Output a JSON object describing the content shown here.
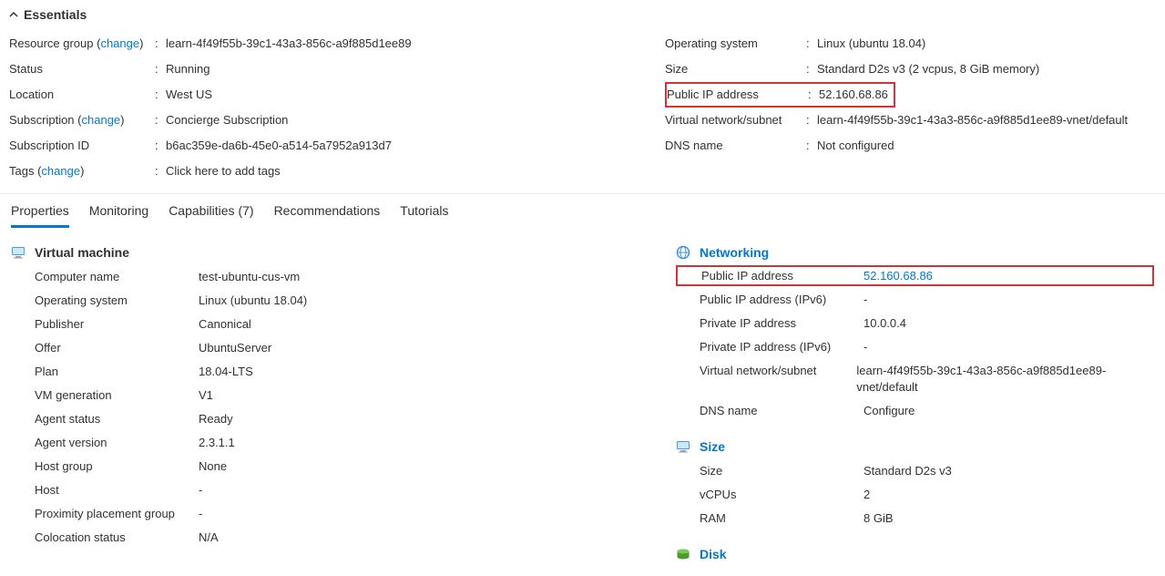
{
  "essentials": {
    "title": "Essentials",
    "left": {
      "resource_group_label": "Resource group",
      "resource_group_change": "change",
      "resource_group_value": "learn-4f49f55b-39c1-43a3-856c-a9f885d1ee89",
      "status_label": "Status",
      "status_value": "Running",
      "location_label": "Location",
      "location_value": "West US",
      "subscription_label": "Subscription",
      "subscription_change": "change",
      "subscription_value": "Concierge Subscription",
      "subscription_id_label": "Subscription ID",
      "subscription_id_value": "b6ac359e-da6b-45e0-a514-5a7952a913d7",
      "tags_label": "Tags",
      "tags_change": "change",
      "tags_value": "Click here to add tags"
    },
    "right": {
      "os_label": "Operating system",
      "os_value": "Linux (ubuntu 18.04)",
      "size_label": "Size",
      "size_value": "Standard D2s v3 (2 vcpus, 8 GiB memory)",
      "public_ip_label": "Public IP address",
      "public_ip_value": "52.160.68.86",
      "vnet_label": "Virtual network/subnet",
      "vnet_value": "learn-4f49f55b-39c1-43a3-856c-a9f885d1ee89-vnet/default",
      "dns_label": "DNS name",
      "dns_value": "Not configured"
    }
  },
  "tabs": {
    "properties": "Properties",
    "monitoring": "Monitoring",
    "capabilities": "Capabilities (7)",
    "recommendations": "Recommendations",
    "tutorials": "Tutorials"
  },
  "vm": {
    "title": "Virtual machine",
    "computer_name_label": "Computer name",
    "computer_name_value": "test-ubuntu-cus-vm",
    "os_label": "Operating system",
    "os_value": "Linux (ubuntu 18.04)",
    "publisher_label": "Publisher",
    "publisher_value": "Canonical",
    "offer_label": "Offer",
    "offer_value": "UbuntuServer",
    "plan_label": "Plan",
    "plan_value": "18.04-LTS",
    "vm_gen_label": "VM generation",
    "vm_gen_value": "V1",
    "agent_status_label": "Agent status",
    "agent_status_value": "Ready",
    "agent_version_label": "Agent version",
    "agent_version_value": "2.3.1.1",
    "host_group_label": "Host group",
    "host_group_value": "None",
    "host_label": "Host",
    "host_value": "-",
    "ppg_label": "Proximity placement group",
    "ppg_value": "-",
    "colocation_label": "Colocation status",
    "colocation_value": "N/A"
  },
  "networking": {
    "title": "Networking",
    "public_ip_label": "Public IP address",
    "public_ip_value": "52.160.68.86",
    "public_ip6_label": "Public IP address (IPv6)",
    "public_ip6_value": "-",
    "private_ip_label": "Private IP address",
    "private_ip_value": "10.0.0.4",
    "private_ip6_label": "Private IP address (IPv6)",
    "private_ip6_value": "-",
    "vnet_label": "Virtual network/subnet",
    "vnet_value": "learn-4f49f55b-39c1-43a3-856c-a9f885d1ee89-vnet/default",
    "dns_label": "DNS name",
    "dns_value": "Configure"
  },
  "size": {
    "title": "Size",
    "size_label": "Size",
    "size_value": "Standard D2s v3",
    "vcpus_label": "vCPUs",
    "vcpus_value": "2",
    "ram_label": "RAM",
    "ram_value": "8 GiB"
  },
  "disk": {
    "title": "Disk"
  }
}
